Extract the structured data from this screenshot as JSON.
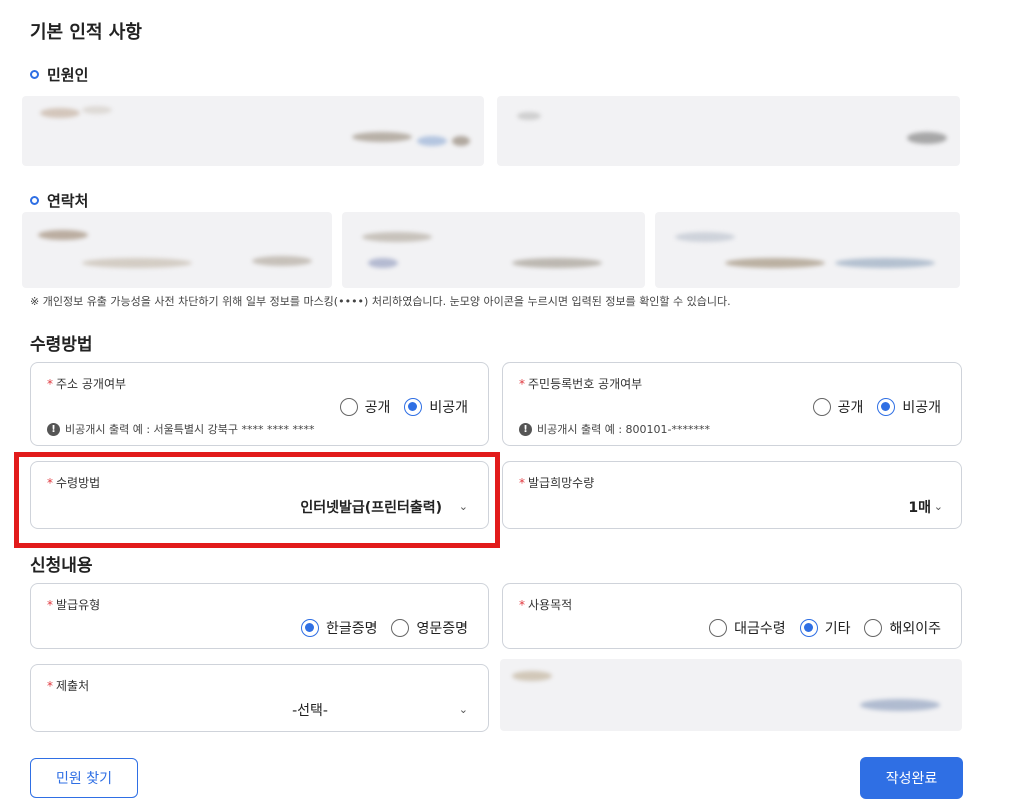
{
  "sections": {
    "basic_info": "기본 인적 사항",
    "applicant": "민원인",
    "contact": "연락처",
    "receipt_method": "수령방법",
    "application": "신청내용"
  },
  "notice": "※ 개인정보 유출 가능성을 사전 차단하기 위해 일부 정보를 마스킹(••••) 처리하였습니다. 눈모양 아이콘을 누르시면 입력된 정보를 확인할 수 있습니다.",
  "required_mark": "*",
  "address_disclosure": {
    "label": "주소 공개여부",
    "options": [
      "공개",
      "비공개"
    ],
    "selected": "비공개",
    "hint": "비공개시 출력 예 : 서울특별시 강북구 **** **** ****"
  },
  "rrn_disclosure": {
    "label": "주민등록번호 공개여부",
    "options": [
      "공개",
      "비공개"
    ],
    "selected": "비공개",
    "hint": "비공개시 출력 예 : 800101-*******"
  },
  "receipt": {
    "label": "수령방법",
    "value": "인터넷발급(프린터출력)"
  },
  "quantity": {
    "label": "발급희망수량",
    "value": "1매"
  },
  "issue_type": {
    "label": "발급유형",
    "options": [
      "한글증명",
      "영문증명"
    ],
    "selected": "한글증명"
  },
  "purpose": {
    "label": "사용목적",
    "options": [
      "대금수령",
      "기타",
      "해외이주"
    ],
    "selected": "기타"
  },
  "submit_to": {
    "label": "제출처",
    "value": "-선택-"
  },
  "buttons": {
    "find": "민원 찾기",
    "complete": "작성완료"
  },
  "colors": {
    "accent": "#2f6fe4",
    "required": "#e0383e",
    "highlight": "#e21b1b"
  },
  "icons": {
    "chevron": "chevron-down-icon",
    "hint": "exclamation-circle-icon",
    "bullet": "ring-bullet-icon"
  }
}
